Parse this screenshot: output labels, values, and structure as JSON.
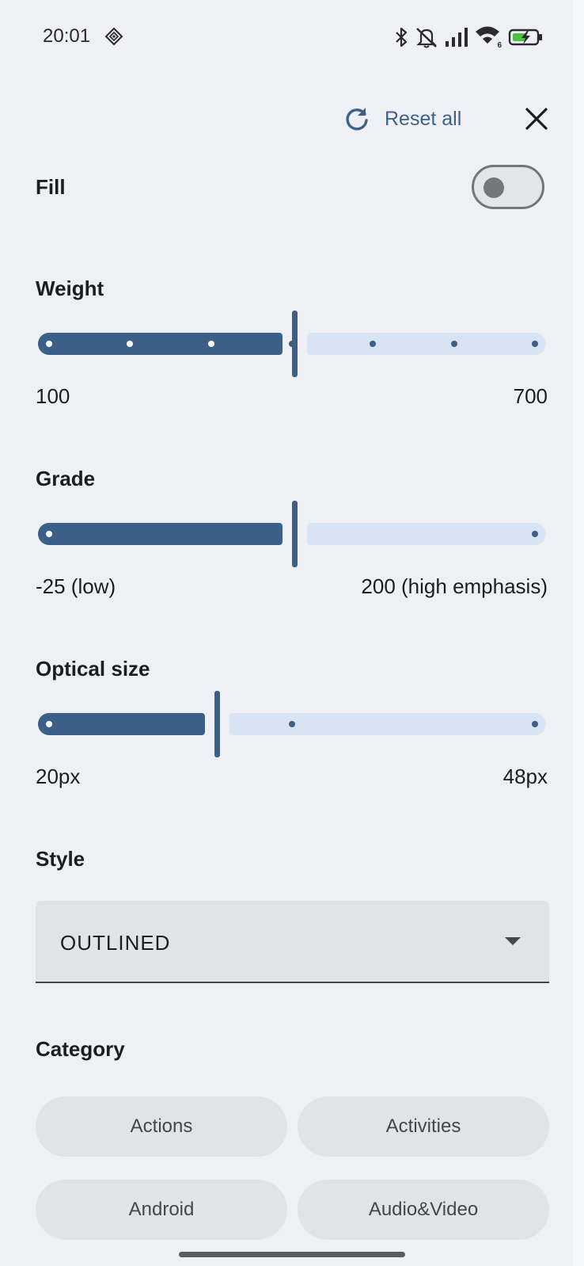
{
  "status_bar": {
    "time": "20:01",
    "wifi_badge": "6",
    "icons": [
      "diamond-icon",
      "bluetooth-icon",
      "bell-off-icon",
      "signal-icon",
      "wifi-icon",
      "battery-charging-icon"
    ]
  },
  "header": {
    "reset_label": "Reset all",
    "icons": [
      "refresh-icon",
      "close-icon"
    ]
  },
  "fill": {
    "label": "Fill",
    "enabled": false
  },
  "weight": {
    "label": "Weight",
    "min_label": "100",
    "max_label": "700",
    "min": 100,
    "max": 700,
    "value": 400,
    "step": 100
  },
  "grade": {
    "label": "Grade",
    "min_label": "-25 (low)",
    "max_label": "200 (high emphasis)",
    "value_fraction": 0.5,
    "ticks": 2
  },
  "optical_size": {
    "label": "Optical size",
    "min_label": "20px",
    "max_label": "48px",
    "value_fraction": 0.34,
    "ticks": 3
  },
  "style": {
    "label": "Style",
    "selected": "OUTLINED"
  },
  "category": {
    "label": "Category",
    "chips": [
      "Actions",
      "Activities",
      "Android",
      "Audio&Video"
    ]
  },
  "colors": {
    "accent": "#3b5f87",
    "track_inactive": "#d8e3f3",
    "background": "#eef0f5"
  }
}
